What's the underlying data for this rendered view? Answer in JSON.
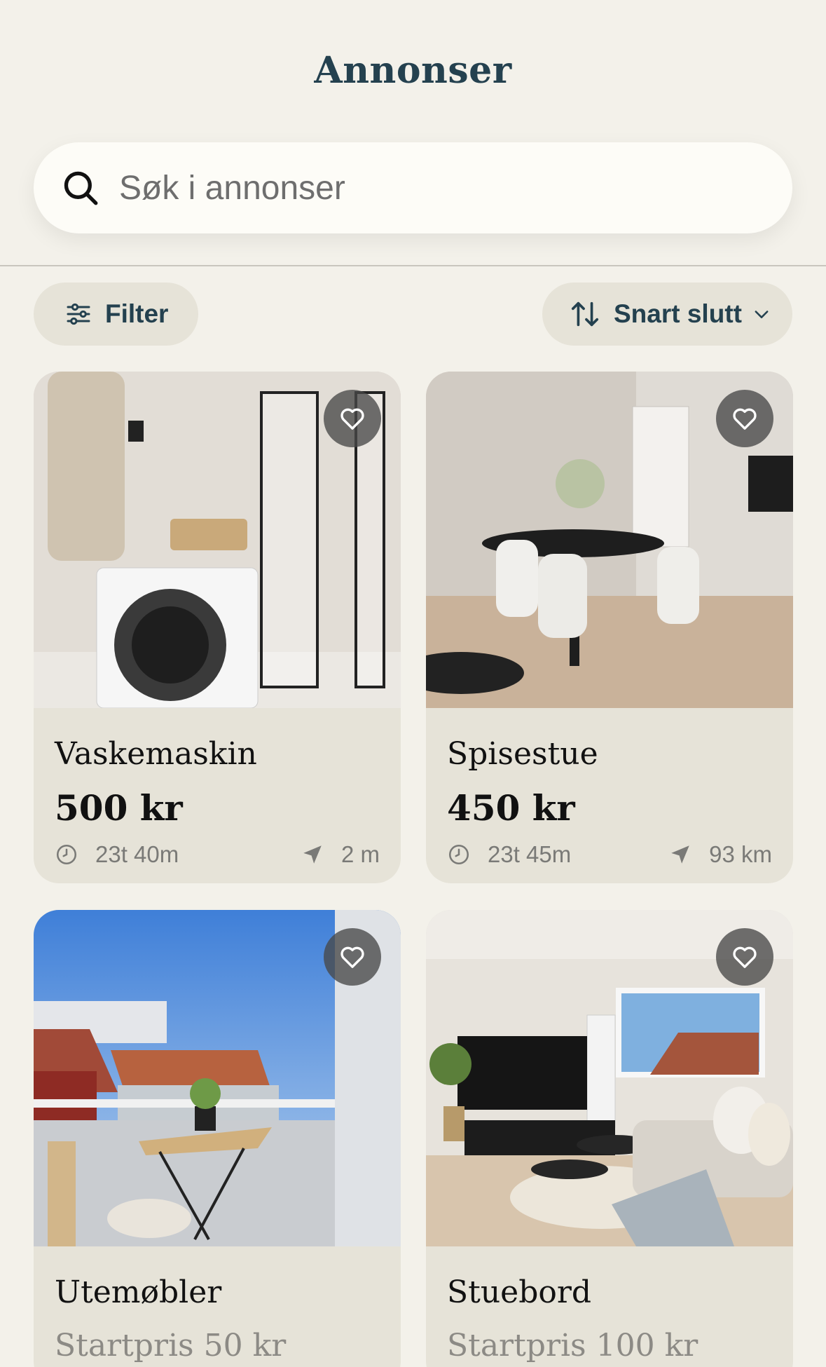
{
  "header": {
    "title": "Annonser"
  },
  "search": {
    "placeholder": "Søk i annonser"
  },
  "toolbar": {
    "filter_label": "Filter",
    "sort_label": "Snart slutt"
  },
  "listings": [
    {
      "title": "Vaskemaskin",
      "price": "500 kr",
      "time_left": "23t 40m",
      "distance": "2 m",
      "photo": "bathroom-washing-machine"
    },
    {
      "title": "Spisestue",
      "price": "450 kr",
      "time_left": "23t 45m",
      "distance": "93 km",
      "photo": "dining-room"
    },
    {
      "title": "Utemøbler",
      "price": "Startpris 50 kr",
      "photo": "balcony-furniture"
    },
    {
      "title": "Stuebord",
      "price": "Startpris 100 kr",
      "photo": "living-room"
    }
  ],
  "icons": {
    "search": "search-icon",
    "filter": "sliders-icon",
    "sort": "sort-arrows-icon",
    "chevron": "chevron-down-icon",
    "favorite": "heart-icon",
    "clock": "clock-icon",
    "location": "location-arrow-icon"
  },
  "colors": {
    "background": "#f3f1ea",
    "card": "#e6e3d8",
    "accent": "#24414f",
    "search_bg": "#fdfcf7"
  }
}
